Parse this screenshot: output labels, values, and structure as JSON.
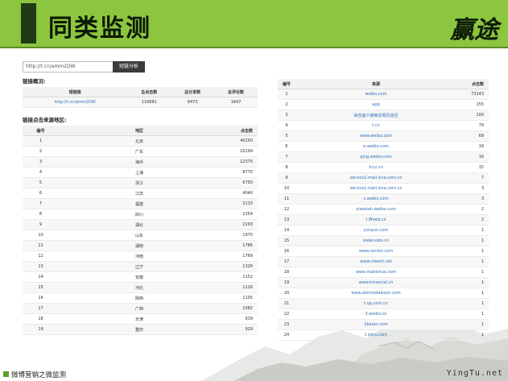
{
  "header": {
    "title": "同类监测",
    "logo_text": "赢途"
  },
  "search": {
    "value": "http://t.cn/amm2DW",
    "button": "短链分析"
  },
  "overview": {
    "title": "链接概况:",
    "headers": [
      "短链接",
      "总点击数",
      "总分享数",
      "总评论数"
    ],
    "row": [
      "http://t.cn/amm2DW",
      "116881",
      "8473",
      "1647"
    ]
  },
  "regions": {
    "title": "链接点击来源地区:",
    "headers": [
      "编号",
      "地区",
      "点击数"
    ],
    "rows": [
      [
        "1",
        "北京",
        "40250"
      ],
      [
        "2",
        "广东",
        "16199"
      ],
      [
        "3",
        "海外",
        "12375"
      ],
      [
        "4",
        "上海",
        "8770"
      ],
      [
        "5",
        "浙江",
        "6750"
      ],
      [
        "6",
        "江苏",
        "4040"
      ],
      [
        "7",
        "福建",
        "3133"
      ],
      [
        "8",
        "四川",
        "2354"
      ],
      [
        "9",
        "湖北",
        "2193"
      ],
      [
        "10",
        "山东",
        "1970"
      ],
      [
        "11",
        "湖南",
        "1786"
      ],
      [
        "12",
        "河南",
        "1769"
      ],
      [
        "13",
        "辽宁",
        "1326"
      ],
      [
        "14",
        "安徽",
        "1152"
      ],
      [
        "15",
        "河北",
        "1126"
      ],
      [
        "16",
        "陕西",
        "1105"
      ],
      [
        "17",
        "广西",
        "1082"
      ],
      [
        "18",
        "天津",
        "939"
      ],
      [
        "19",
        "重庆",
        "929"
      ]
    ]
  },
  "sources": {
    "headers": [
      "编号",
      "来源",
      "点击数"
    ],
    "rows": [
      [
        "1",
        "weibo.com",
        "73143"
      ],
      [
        "2",
        "app",
        "155"
      ],
      [
        "3",
        "来自客户端等非网页途径",
        "100"
      ],
      [
        "4",
        "t.cn",
        "79"
      ],
      [
        "5",
        "www.weibo.com",
        "69"
      ],
      [
        "6",
        "e.weibo.com",
        "19"
      ],
      [
        "7",
        "qing.weibo.com",
        "16"
      ],
      [
        "8",
        "tccz.cn",
        "15"
      ],
      [
        "9",
        "service2.mail.sina.com.cn",
        "7"
      ],
      [
        "10",
        "service1.mail.sina.com.cn",
        "3"
      ],
      [
        "11",
        "s.weibo.com",
        "3"
      ],
      [
        "12",
        "xiaoxiah.weibo.com",
        "2"
      ],
      [
        "13",
        "t.8feed.cn",
        "2"
      ],
      [
        "14",
        "yunyun.com",
        "1"
      ],
      [
        "15",
        "www.vsbs.cn",
        "1"
      ],
      [
        "16",
        "www.renren.com",
        "1"
      ],
      [
        "17",
        "www.nieesh.net",
        "1"
      ],
      [
        "18",
        "www.madishux.com",
        "1"
      ],
      [
        "19",
        "www.kmsocial.cn",
        "1"
      ],
      [
        "20",
        "www.dennisdawson.com",
        "1"
      ],
      [
        "21",
        "t.qq.com.cn",
        "1"
      ],
      [
        "22",
        "3.weibo.cn",
        "1"
      ],
      [
        "23",
        "2biuon.com",
        "1"
      ],
      [
        "24",
        "t.sohu.com",
        "1"
      ]
    ]
  },
  "footer": {
    "text": "微博营销之微监测",
    "watermark": "YingTu.net"
  },
  "colors": {
    "header_green": "#8cc63f",
    "dark_bar": "#1f3a14",
    "link_blue": "#2f6fb5",
    "footer_green": "#5aa02c"
  }
}
